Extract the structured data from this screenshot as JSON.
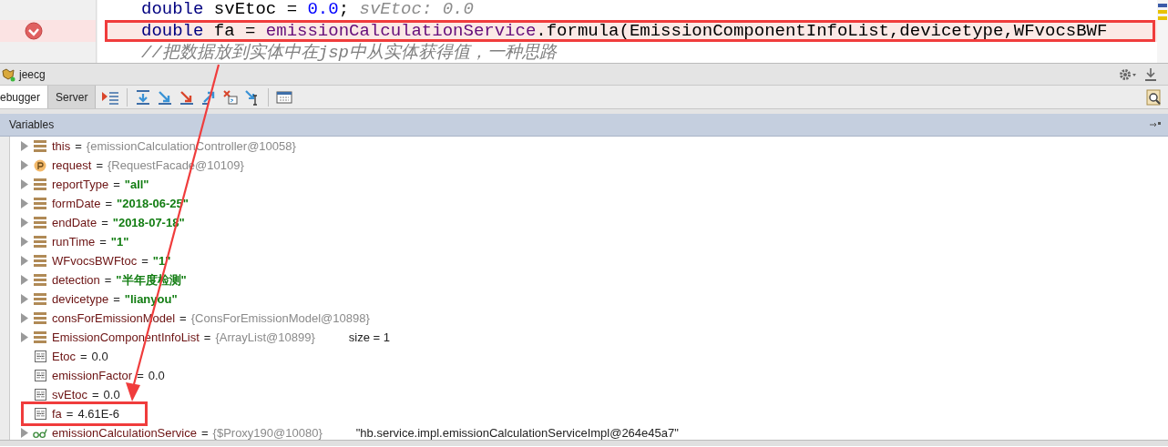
{
  "editor": {
    "lines": [
      {
        "breakpoint": false,
        "highlighted": false,
        "tokens": [
          {
            "kind": "keyword",
            "text": "double"
          },
          {
            "kind": "plain",
            "text": " svEtoc = "
          },
          {
            "kind": "number",
            "text": "0.0"
          },
          {
            "kind": "plain",
            "text": ";  "
          },
          {
            "kind": "hint",
            "text": "svEtoc: 0.0"
          }
        ]
      },
      {
        "breakpoint": true,
        "highlighted": true,
        "tokens": [
          {
            "kind": "keyword",
            "text": "double"
          },
          {
            "kind": "plain",
            "text": " fa = "
          },
          {
            "kind": "field",
            "text": "emissionCalculationService"
          },
          {
            "kind": "plain",
            "text": ".formula(EmissionComponentInfoList,devicetype,WFvocsBWF"
          }
        ]
      },
      {
        "breakpoint": false,
        "highlighted": false,
        "tokens": [
          {
            "kind": "comment",
            "text": "//把数据放到实体中在jsp中从实体获得值，一种思路"
          }
        ]
      }
    ]
  },
  "debug_window": {
    "title": "jeecg"
  },
  "tabs": [
    {
      "label": "ebugger",
      "selected": true
    },
    {
      "label": "Server",
      "selected": false
    }
  ],
  "variables": {
    "title": "Variables",
    "rows": [
      {
        "kind": "field",
        "expandable": true,
        "name": "this",
        "operator": "=",
        "object": "{emissionCalculationController@10058}",
        "highlighted": false
      },
      {
        "kind": "param",
        "expandable": true,
        "name": "request",
        "operator": "=",
        "object": "{RequestFacade@10109}",
        "highlighted": false
      },
      {
        "kind": "field",
        "expandable": true,
        "name": "reportType",
        "operator": "=",
        "value": "\"all\"",
        "highlighted": false
      },
      {
        "kind": "field",
        "expandable": true,
        "name": "formDate",
        "operator": "=",
        "value": "\"2018-06-25\"",
        "highlighted": false
      },
      {
        "kind": "field",
        "expandable": true,
        "name": "endDate",
        "operator": "=",
        "value": "\"2018-07-18\"",
        "highlighted": false
      },
      {
        "kind": "field",
        "expandable": true,
        "name": "runTime",
        "operator": "=",
        "value": "\"1\"",
        "highlighted": false
      },
      {
        "kind": "field",
        "expandable": true,
        "name": "WFvocsBWFtoc",
        "operator": "=",
        "value": "\"1\"",
        "highlighted": false
      },
      {
        "kind": "field",
        "expandable": true,
        "name": "detection",
        "operator": "=",
        "value": "\"半年度检测\"",
        "highlighted": false
      },
      {
        "kind": "field",
        "expandable": true,
        "name": "devicetype",
        "operator": "=",
        "value": "\"lianyou\"",
        "highlighted": false
      },
      {
        "kind": "field",
        "expandable": true,
        "name": "consForEmissionModel",
        "operator": "=",
        "object": "{ConsForEmissionModel@10898}",
        "highlighted": false
      },
      {
        "kind": "field",
        "expandable": true,
        "name": "EmissionComponentInfoList",
        "operator": "=",
        "object": "{ArrayList@10899}",
        "extra": "size = 1",
        "highlighted": false
      },
      {
        "kind": "primitive",
        "expandable": false,
        "name": "Etoc",
        "operator": "=",
        "value": "0.0",
        "highlighted": false
      },
      {
        "kind": "primitive",
        "expandable": false,
        "name": "emissionFactor",
        "operator": "=",
        "value": "0.0",
        "highlighted": false
      },
      {
        "kind": "primitive",
        "expandable": false,
        "name": "svEtoc",
        "operator": "=",
        "value": "0.0",
        "highlighted": false
      },
      {
        "kind": "primitive",
        "expandable": false,
        "name": "fa",
        "operator": "=",
        "value": "4.61E-6",
        "highlighted": true
      },
      {
        "kind": "watch",
        "expandable": true,
        "name": "emissionCalculationService",
        "operator": "=",
        "object": "{$Proxy190@10080}",
        "extra": "\"hb.service.impl.emissionCalculationServiceImpl@264e45a7\"",
        "highlighted": false
      }
    ]
  }
}
